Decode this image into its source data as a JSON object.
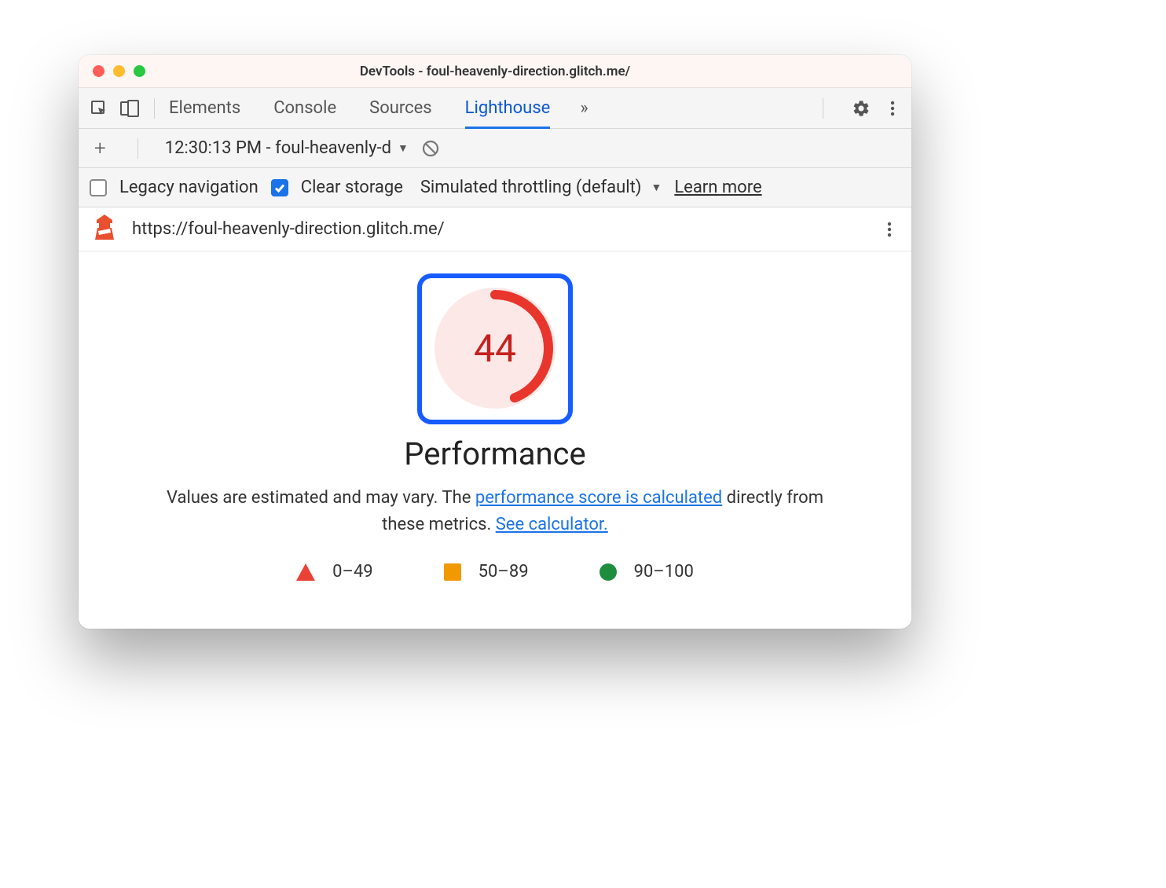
{
  "window": {
    "title": "DevTools - foul-heavenly-direction.glitch.me/"
  },
  "tabs": {
    "elements": "Elements",
    "console": "Console",
    "sources": "Sources",
    "lighthouse": "Lighthouse"
  },
  "subtoolbar": {
    "run_label": "12:30:13 PM - foul-heavenly-d"
  },
  "options": {
    "legacy_label": "Legacy navigation",
    "legacy_checked": false,
    "clear_storage_label": "Clear storage",
    "clear_storage_checked": true,
    "throttling_label": "Simulated throttling (default)",
    "learn_more": "Learn more"
  },
  "url_row": {
    "url": "https://foul-heavenly-direction.glitch.me/"
  },
  "report": {
    "score": "44",
    "title": "Performance",
    "desc_pre": "Values are estimated and may vary. The ",
    "link1": "performance score is calculated",
    "desc_mid": " directly from these metrics. ",
    "link2": "See calculator.",
    "legend": {
      "poor": "0–49",
      "avg": "50–89",
      "good": "90–100"
    }
  },
  "chart_data": {
    "type": "pie",
    "title": "Performance",
    "categories": [
      "score",
      "remaining"
    ],
    "values": [
      44,
      56
    ],
    "ylim": [
      0,
      100
    ],
    "colors": {
      "score": "#c5221f",
      "remaining": "#fde8e8"
    }
  }
}
